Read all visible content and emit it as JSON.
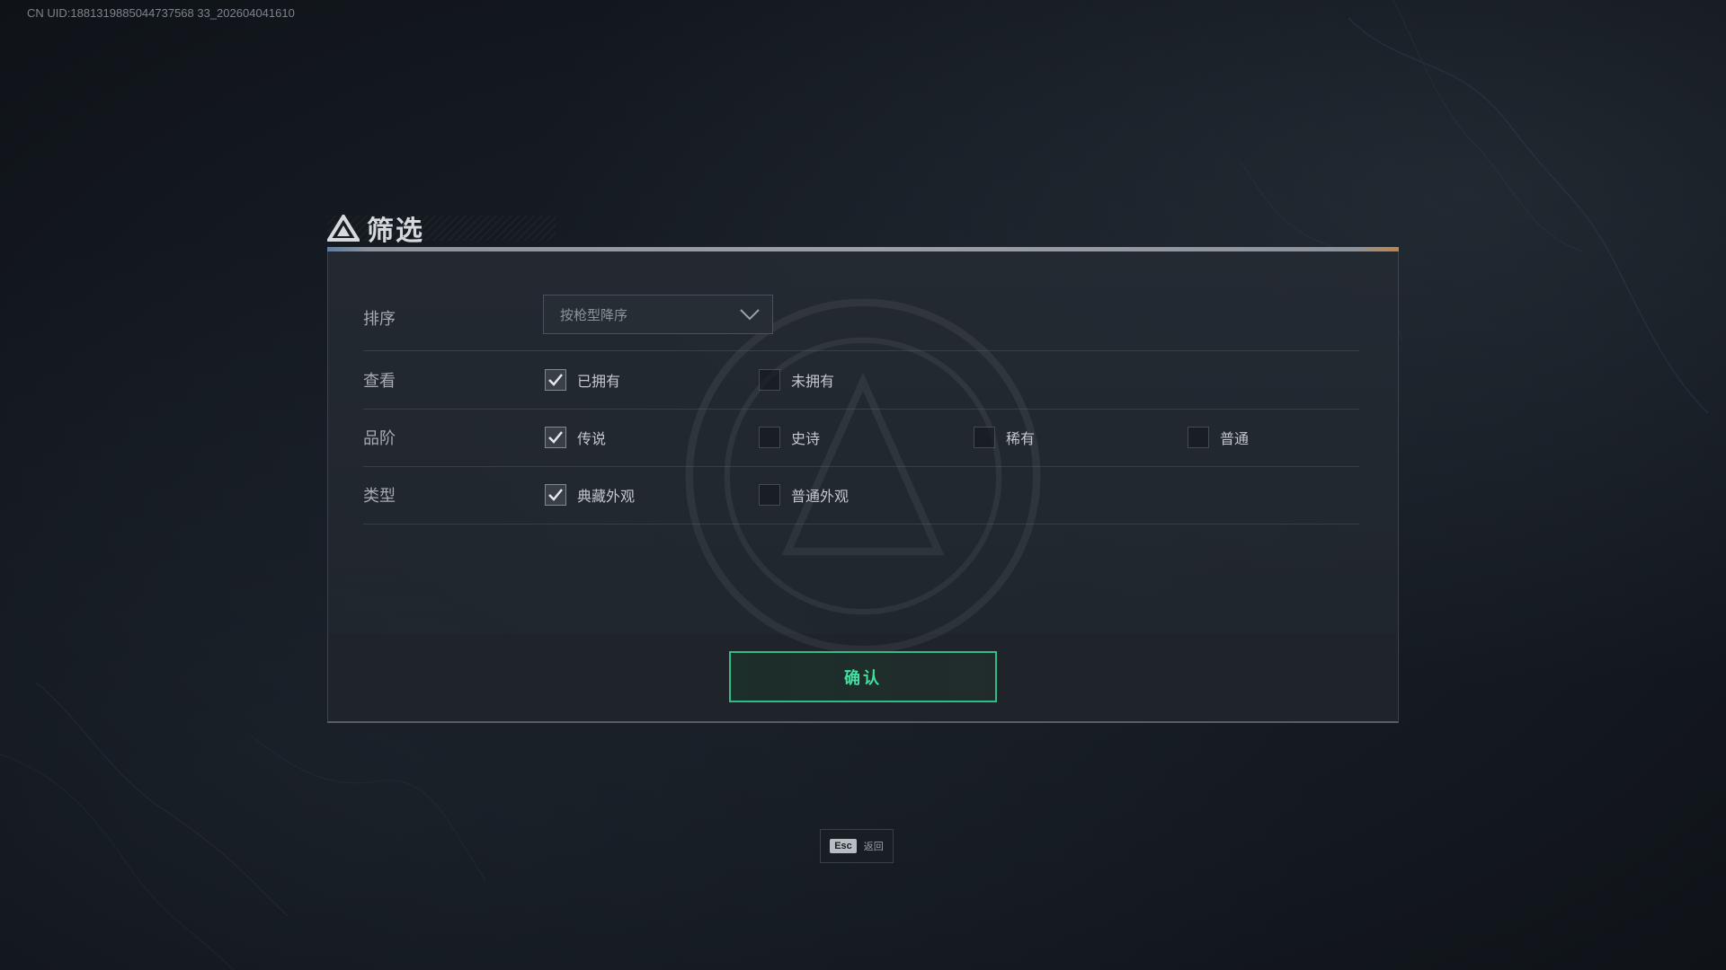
{
  "uid_text": "CN UID:1881319885044737568 33_202604041610",
  "dialog": {
    "title": "筛选",
    "sort": {
      "label": "排序",
      "selected": "按枪型降序"
    },
    "view": {
      "label": "查看",
      "options": [
        {
          "label": "已拥有",
          "checked": true
        },
        {
          "label": "未拥有",
          "checked": false
        }
      ]
    },
    "rarity": {
      "label": "品阶",
      "options": [
        {
          "label": "传说",
          "checked": true
        },
        {
          "label": "史诗",
          "checked": false
        },
        {
          "label": "稀有",
          "checked": false
        },
        {
          "label": "普通",
          "checked": false
        }
      ]
    },
    "type": {
      "label": "类型",
      "options": [
        {
          "label": "典藏外观",
          "checked": true
        },
        {
          "label": "普通外观",
          "checked": false
        }
      ]
    },
    "confirm_label": "确认"
  },
  "esc_hint": {
    "key": "Esc",
    "label": "返回"
  },
  "colors": {
    "accent": "#2fbf86",
    "confirm_text": "#3fe0a0",
    "background": "#141920"
  }
}
